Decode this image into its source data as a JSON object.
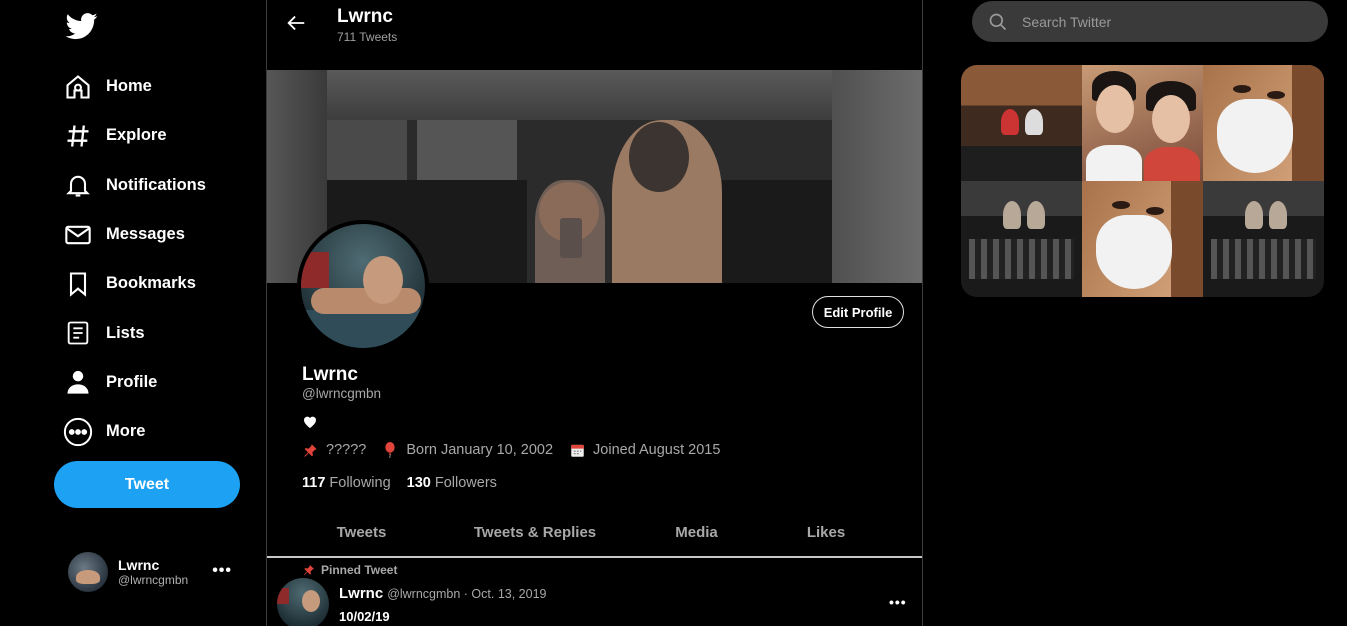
{
  "nav": {
    "items": [
      {
        "label": "Home",
        "icon": "home-icon"
      },
      {
        "label": "Explore",
        "icon": "hashtag-icon"
      },
      {
        "label": "Notifications",
        "icon": "bell-icon"
      },
      {
        "label": "Messages",
        "icon": "envelope-icon"
      },
      {
        "label": "Bookmarks",
        "icon": "bookmark-icon"
      },
      {
        "label": "Lists",
        "icon": "list-icon"
      },
      {
        "label": "Profile",
        "icon": "person-icon"
      },
      {
        "label": "More",
        "icon": "more-circle-icon"
      }
    ],
    "tweet_label": "Tweet"
  },
  "account": {
    "name": "Lwrnc",
    "handle": "@lwrncgmbn",
    "menu": "•••"
  },
  "header": {
    "name": "Lwrnc",
    "tweet_count": "711 Tweets"
  },
  "profile": {
    "edit_label": "Edit Profile",
    "name": "Lwrnc",
    "handle": "@lwrncgmbn",
    "bio_icon": "white-heart-icon",
    "location": "?????",
    "birthday": "Born January 10, 2002",
    "joined": "Joined August 2015",
    "following_count": "117",
    "following_label": "Following",
    "followers_count": "130",
    "followers_label": "Followers"
  },
  "tabs": [
    {
      "label": "Tweets"
    },
    {
      "label": "Tweets & Replies"
    },
    {
      "label": "Media"
    },
    {
      "label": "Likes"
    }
  ],
  "pinned_tweet": {
    "pinned_label": "Pinned Tweet",
    "name": "Lwrnc",
    "meta": "@lwrncgmbn · Oct. 13, 2019",
    "text": "10/02/19",
    "menu": "•••"
  },
  "search": {
    "placeholder": "Search Twitter"
  },
  "colors": {
    "accent": "#1da1f2",
    "background": "#000000",
    "muted_text": "#a8a8a8",
    "search_bg": "#3a3a3a"
  }
}
